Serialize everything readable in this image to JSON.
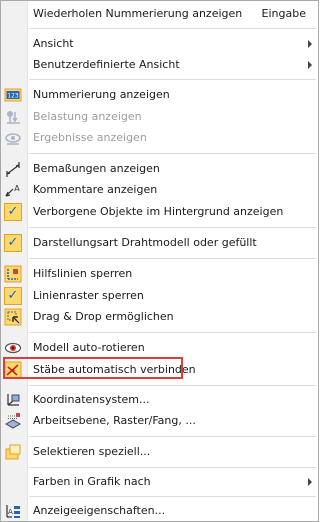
{
  "menu": {
    "items": [
      {
        "label": "Wiederholen Nummerierung anzeigen",
        "shortcut": "Eingabe"
      },
      {
        "label": "Ansicht"
      },
      {
        "label": "Benutzerdefinierte Ansicht"
      },
      {
        "label": "Nummerierung anzeigen"
      },
      {
        "label": "Belastung anzeigen"
      },
      {
        "label": "Ergebnisse anzeigen"
      },
      {
        "label": "Bemaßungen anzeigen"
      },
      {
        "label": "Kommentare anzeigen"
      },
      {
        "label": "Verborgene Objekte im Hintergrund anzeigen"
      },
      {
        "label": "Darstellungsart Drahtmodell oder gefüllt"
      },
      {
        "label": "Hilfslinien sperren"
      },
      {
        "label": "Linienraster sperren"
      },
      {
        "label": "Drag & Drop ermöglichen"
      },
      {
        "label": "Modell auto-rotieren"
      },
      {
        "label": "Stäbe automatisch verbinden"
      },
      {
        "label": "Koordinatensystem..."
      },
      {
        "label": "Arbeitsebene, Raster/Fang, ..."
      },
      {
        "label": "Selektieren speziell..."
      },
      {
        "label": "Farben in Grafik nach"
      },
      {
        "label": "Anzeigeeigenschaften..."
      }
    ],
    "check_mark": "✓",
    "icons": {
      "numbering": "numbering-123-icon",
      "load": "load-icon",
      "results": "results-icon",
      "dimensions": "dimension-icon",
      "comments": "comment-icon",
      "auto_rotate": "eye-rotate-icon",
      "connect_members": "connect-members-icon",
      "coordinate_system": "coordinate-system-icon",
      "work_plane": "work-plane-icon",
      "select_special": "select-special-icon",
      "display_properties": "display-properties-icon"
    },
    "colors": {
      "highlight_border": "#e03c3c",
      "check_bg": "#fbd96b",
      "check_mark": "#1d5fb8",
      "disabled_text": "#9d9d9d"
    }
  }
}
